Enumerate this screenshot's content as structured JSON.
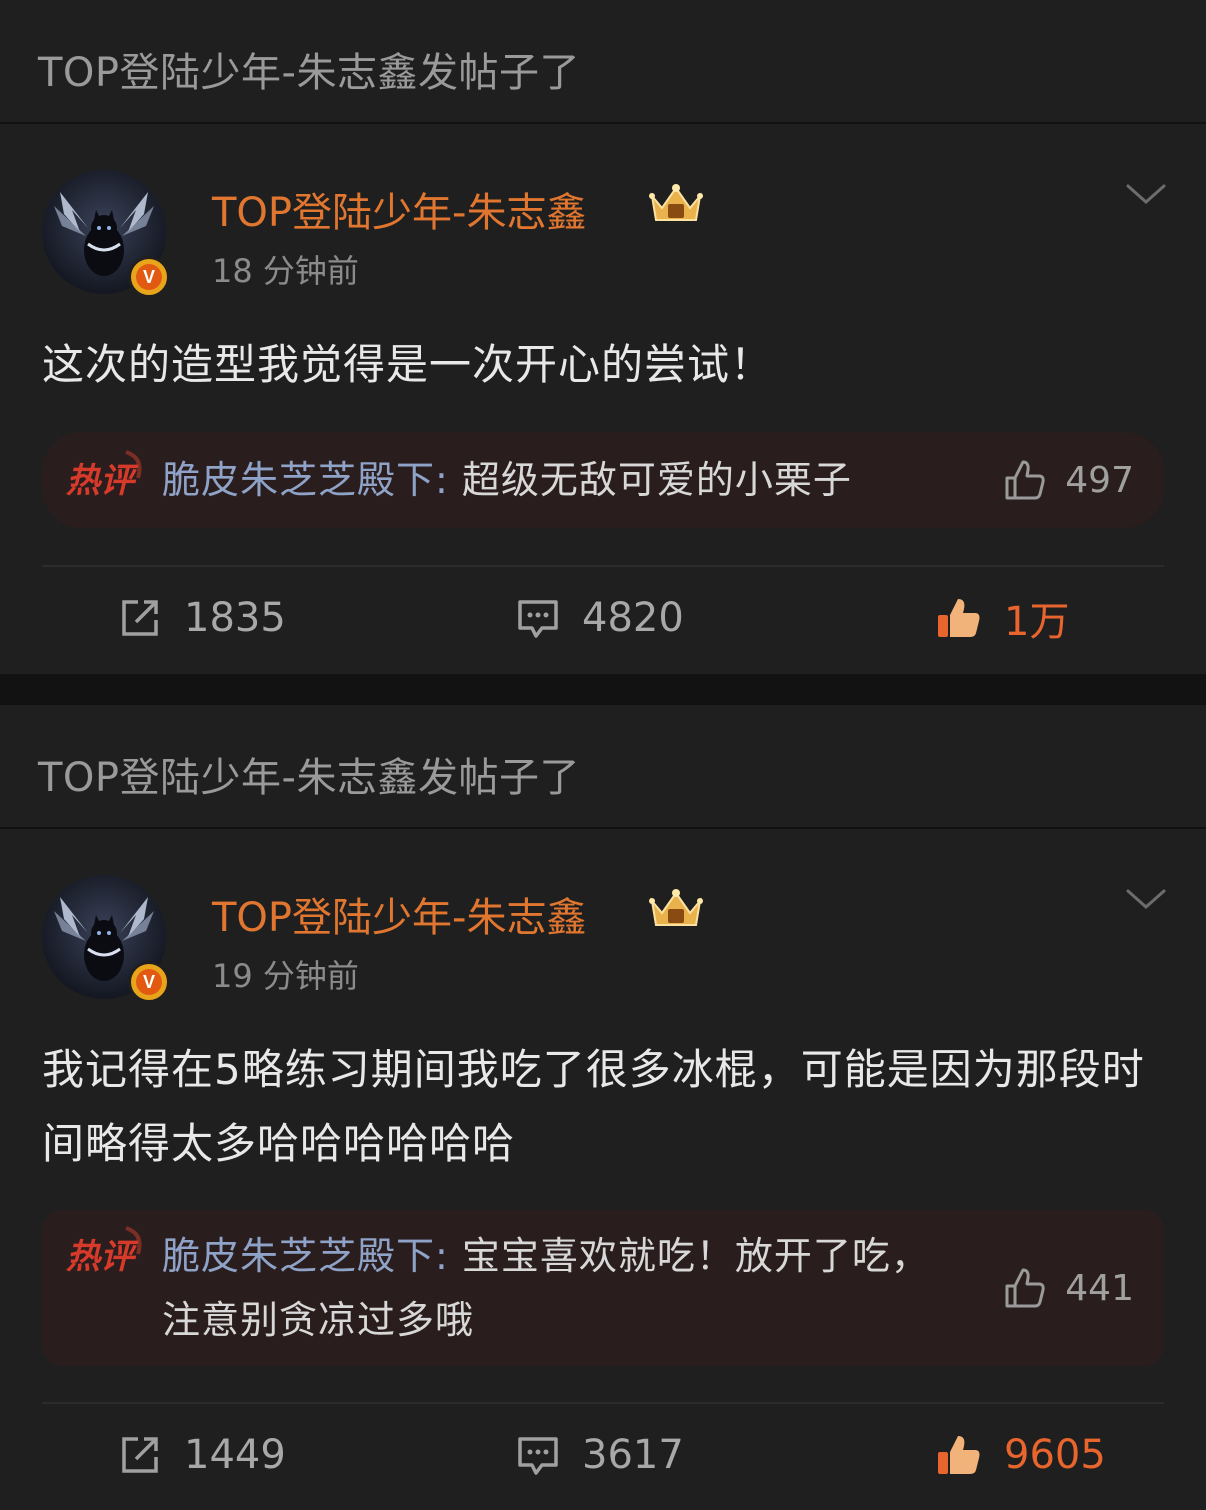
{
  "posts": [
    {
      "repost_header": "TOP登陆少年-朱志鑫发帖子了",
      "username": "TOP登陆少年-朱志鑫",
      "time": "18 分钟前",
      "content": "这次的造型我觉得是一次开心的尝试！",
      "hot_comment": {
        "tag": "热评",
        "author": "脆皮朱芝芝殿下:",
        "text": " 超级无敌可爱的小栗子",
        "likes": "497"
      },
      "actions": {
        "reposts": "1835",
        "comments": "4820",
        "likes": "1万"
      }
    },
    {
      "repost_header": "TOP登陆少年-朱志鑫发帖子了",
      "username": "TOP登陆少年-朱志鑫",
      "time": "19 分钟前",
      "content": "我记得在5略练习期间我吃了很多冰棍，可能是因为那段时间略得太多哈哈哈哈哈哈",
      "hot_comment": {
        "tag": "热评",
        "author": "脆皮朱芝芝殿下:",
        "text": " 宝宝喜欢就吃！放开了吃，注意别贪凉过多哦",
        "likes": "441"
      },
      "actions": {
        "reposts": "1449",
        "comments": "3617",
        "likes": "9605"
      }
    }
  ],
  "colors": {
    "background": "#1f1f1f",
    "username": "#e0762f",
    "hot_comment_bg": "#2a1d1d",
    "hot_author": "#8fa3c8",
    "liked": "#e8652e"
  },
  "icons": {
    "repost": "repost-icon",
    "comment": "comment-icon",
    "like": "thumbs-up-icon",
    "verified": "verified-badge-icon",
    "crown": "crown-icon",
    "chevron": "chevron-down-icon"
  }
}
